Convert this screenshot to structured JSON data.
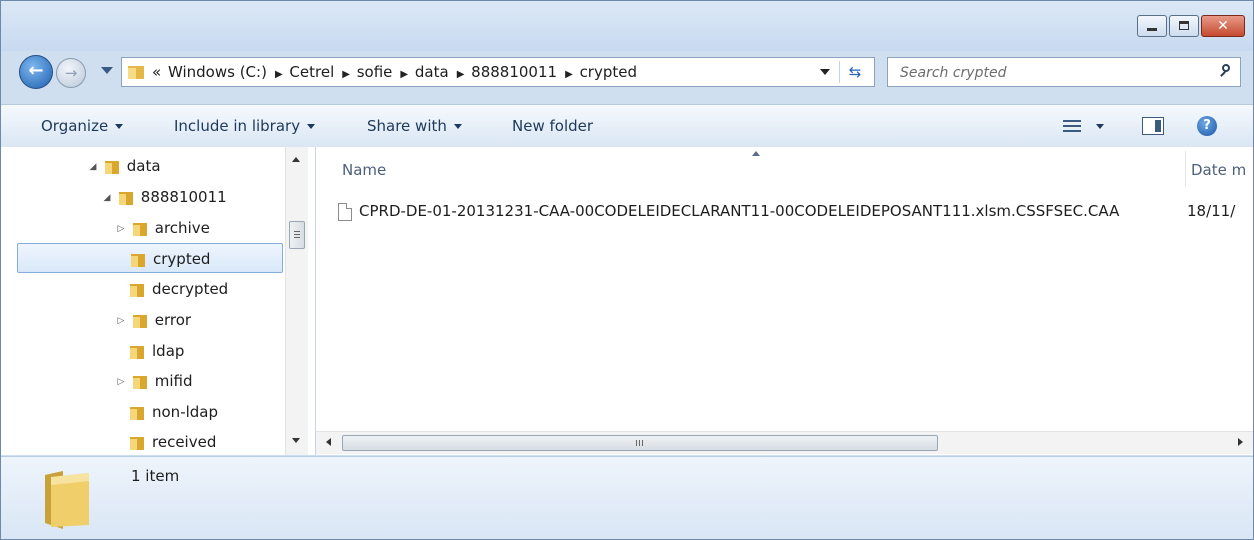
{
  "window": {
    "controls": {
      "minimize": "minimize-icon",
      "maximize": "maximize-icon",
      "close": "close-icon"
    }
  },
  "address": {
    "overflow": "«",
    "crumbs": [
      "Windows (C:)",
      "Cetrel",
      "sofie",
      "data",
      "888810011",
      "crypted"
    ]
  },
  "search": {
    "placeholder": "Search crypted"
  },
  "toolbar": {
    "organize": "Organize",
    "include_in_library": "Include in library",
    "share_with": "Share with",
    "new_folder": "New folder",
    "help": "?"
  },
  "tree": {
    "items": [
      {
        "label": "data",
        "expanded": true
      },
      {
        "label": "888810011",
        "expanded": true
      },
      {
        "label": "archive",
        "expandable": true
      },
      {
        "label": "crypted",
        "selected": true
      },
      {
        "label": "decrypted"
      },
      {
        "label": "error",
        "expandable": true
      },
      {
        "label": "ldap"
      },
      {
        "label": "mifid",
        "expandable": true
      },
      {
        "label": "non-ldap"
      },
      {
        "label": "received"
      }
    ]
  },
  "files": {
    "columns": {
      "name": "Name",
      "date": "Date m"
    },
    "rows": [
      {
        "name": "CPRD-DE-01-20131231-CAA-00CODELEIDECLARANT11-00CODELEIDEPOSANT111.xlsm.CSSFSEC.CAA",
        "date": "18/11/"
      }
    ]
  },
  "status": {
    "count": "1 item"
  },
  "colors": {
    "selection": "#d9e8f9",
    "folder": "#e8c25a",
    "accent": "#1e395b"
  }
}
